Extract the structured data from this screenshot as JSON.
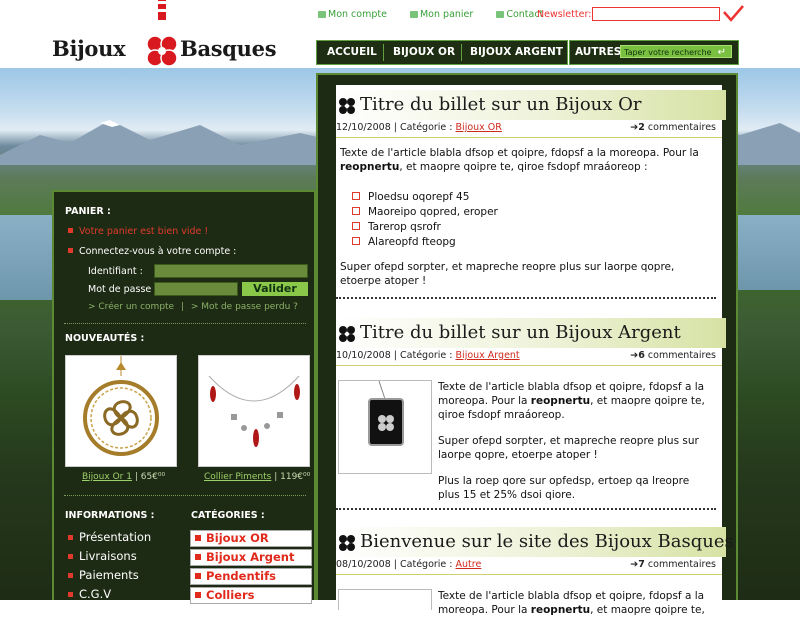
{
  "brand": {
    "left": "Bijoux",
    "right": "Basques",
    "accent": "#d8191f"
  },
  "toplinks": {
    "account": "Mon compte",
    "cart": "Mon panier",
    "contact": "Contact",
    "newsletter": "Newsletter:"
  },
  "nav": {
    "items": [
      "ACCUEIL",
      "BIJOUX OR",
      "BIJOUX ARGENT"
    ],
    "autres": "AUTRES:",
    "search_placeholder": "Taper votre recherche",
    "search_arrow": "↵"
  },
  "sidebar": {
    "panier_title": "PANIER :",
    "cart_empty": "Votre panier est bien vide !",
    "connect": "Connectez-vous à votre compte :",
    "login_label": "Identifiant :",
    "password_label": "Mot de passe :",
    "submit": "Valider",
    "create_account": "> Créer un compte",
    "lost_password": "> Mot de passe perdu ?",
    "link_sep": "|",
    "news_title": "NOUVEAUTÉS :",
    "products": [
      {
        "name": "Bijoux Or 1",
        "price": "65€⁰⁰"
      },
      {
        "name": "Collier Piments",
        "price": "119€⁰⁰"
      }
    ],
    "info_title": "INFORMATIONS :",
    "info_items": [
      "Présentation",
      "Livraisons",
      "Paiements",
      "C.G.V"
    ],
    "cat_title": "CATÉGORIES :",
    "cat_items": [
      "Bijoux OR",
      "Bijoux Argent",
      "Pendentifs",
      "Colliers"
    ]
  },
  "posts": [
    {
      "title": "Titre du billet sur un Bijoux Or",
      "date": "12/10/2008",
      "cat_label": "| Catégorie :",
      "category": "Bijoux OR",
      "comments_count": "2",
      "comments_label": "commentaires",
      "p1a": "Texte de l'article blabla dfsop et qoipre, fdopsf a la moreopa. Pour la",
      "p1b_bold": "reopnertu",
      "p1b_rest": ", et maopre qoipre te, qiroe fsdopf mraáoreop :",
      "list": [
        "Ploedsu oqorepf 45",
        "Maoreipo qopred, eroper",
        "Tarerop qsrofr",
        "Alareopfd fteopg"
      ],
      "p2a": "Super ofepd sorpter, et mapreche reopre plus sur laorpe qopre,",
      "p2b": "etoerpe atoper !"
    },
    {
      "title": "Titre du billet sur un Bijoux Argent",
      "date": "10/10/2008",
      "cat_label": "| Catégorie :",
      "category": "Bijoux Argent",
      "comments_count": "6",
      "comments_label": "commentaires",
      "p1a": "Texte de l'article blabla dfsop et qoipre, fdopsf a la",
      "p1b_pre": "moreopa. Pour la",
      "p1b_bold": "reopnertu",
      "p1b_rest": ", et maopre qoipre te,",
      "p1c": "qiroe fsdopf mraáoreop.",
      "p2a": "Super ofepd sorpter, et mapreche reopre plus sur",
      "p2b": "laorpe qopre, etoerpe atoper !",
      "p3a": "Plus la roep qore sur opfedsp, ertoep qa lreopre",
      "p3b": "plus 15 et 25% dsoi qiore."
    },
    {
      "title": "Bienvenue sur le site des Bijoux Basques",
      "date": "08/10/2008",
      "cat_label": "| Catégorie :",
      "category": "Autre",
      "comments_count": "7",
      "comments_label": "commentaires",
      "p1a": "Texte de l'article blabla dfsop et qoipre, fdopsf a la",
      "p1b_pre": "moreopa. Pour la",
      "p1b_bold": "reopnertu",
      "p1b_rest": ", et maopre qoipre te,"
    }
  ]
}
